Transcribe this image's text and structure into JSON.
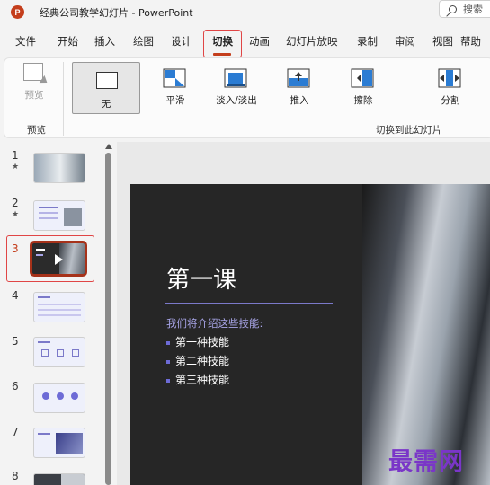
{
  "window": {
    "title": "经典公司教学幻灯片 - PowerPoint",
    "app_logo": "P",
    "search_label": "搜索"
  },
  "tabs": [
    {
      "label": "文件"
    },
    {
      "label": "开始"
    },
    {
      "label": "插入"
    },
    {
      "label": "绘图"
    },
    {
      "label": "设计"
    },
    {
      "label": "切换",
      "active": true
    },
    {
      "label": "动画"
    },
    {
      "label": "幻灯片放映"
    },
    {
      "label": "录制"
    },
    {
      "label": "审阅"
    },
    {
      "label": "视图"
    },
    {
      "label": "帮助"
    }
  ],
  "ribbon": {
    "preview_label": "预览",
    "preview_group_label": "预览",
    "transitions_group_label": "切换到此幻灯片",
    "transitions": [
      {
        "label": "无",
        "selected": true,
        "icon": "none-transition-icon"
      },
      {
        "label": "平滑",
        "icon": "morph-transition-icon"
      },
      {
        "label": "淡入/淡出",
        "icon": "fade-transition-icon"
      },
      {
        "label": "推入",
        "icon": "push-transition-icon"
      },
      {
        "label": "擦除",
        "icon": "wipe-transition-icon"
      },
      {
        "label": "分割",
        "icon": "split-transition-icon"
      }
    ]
  },
  "slides": [
    {
      "number": "1",
      "star": "★"
    },
    {
      "number": "2",
      "star": "★"
    },
    {
      "number": "3",
      "selected": true
    },
    {
      "number": "4"
    },
    {
      "number": "5"
    },
    {
      "number": "6"
    },
    {
      "number": "7"
    },
    {
      "number": "8"
    }
  ],
  "current_slide": {
    "title": "第一课",
    "subtitle": "我们将介绍这些技能:",
    "bullets": [
      "第一种技能",
      "第二种技能",
      "第三种技能"
    ]
  },
  "watermark": "最需网",
  "colors": {
    "accent": "#c43e1c",
    "highlight": "#e04545",
    "slide_bg": "#262626",
    "slide_accent": "#6d6bd6"
  }
}
